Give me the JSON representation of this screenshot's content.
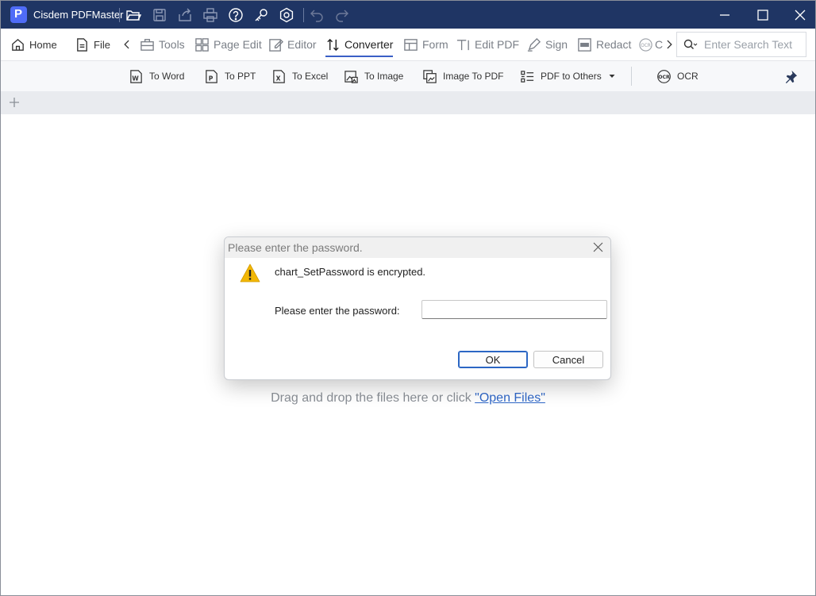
{
  "app": {
    "name": "Cisdem PDFMaster",
    "logo_letter": "P"
  },
  "colors": {
    "titlebar": "#1f3564",
    "accent": "#3a5fc6",
    "link": "#2f67c8",
    "warning": "#f2b705"
  },
  "titlebar_icons": [
    "open-folder-icon",
    "save-icon",
    "share-icon",
    "print-icon",
    "help-icon",
    "key-icon",
    "settings-icon",
    "undo-icon",
    "redo-icon"
  ],
  "window_controls": [
    "minimize-icon",
    "maximize-icon",
    "close-icon"
  ],
  "menu": {
    "home": "Home",
    "file": "File",
    "tools": "Tools",
    "page_edit": "Page Edit",
    "editor": "Editor",
    "converter": "Converter",
    "form": "Form",
    "edit_pdf": "Edit PDF",
    "sign": "Sign",
    "redact": "Redact",
    "ocr_partial": "C"
  },
  "search": {
    "placeholder": "Enter Search Text"
  },
  "toolbar": {
    "to_word": "To Word",
    "to_ppt": "To PPT",
    "to_excel": "To Excel",
    "to_image": "To Image",
    "image_to_pdf": "Image To PDF",
    "pdf_to_others": "PDF to Others",
    "ocr": "OCR"
  },
  "content": {
    "drop_text": "Drag and drop the files here or click ",
    "open_files_link": "\"Open Files\""
  },
  "dialog": {
    "title": "Please enter the password.",
    "message": "chart_SetPassword is encrypted.",
    "label": "Please enter the password:",
    "password_value": "",
    "ok": "OK",
    "cancel": "Cancel"
  }
}
